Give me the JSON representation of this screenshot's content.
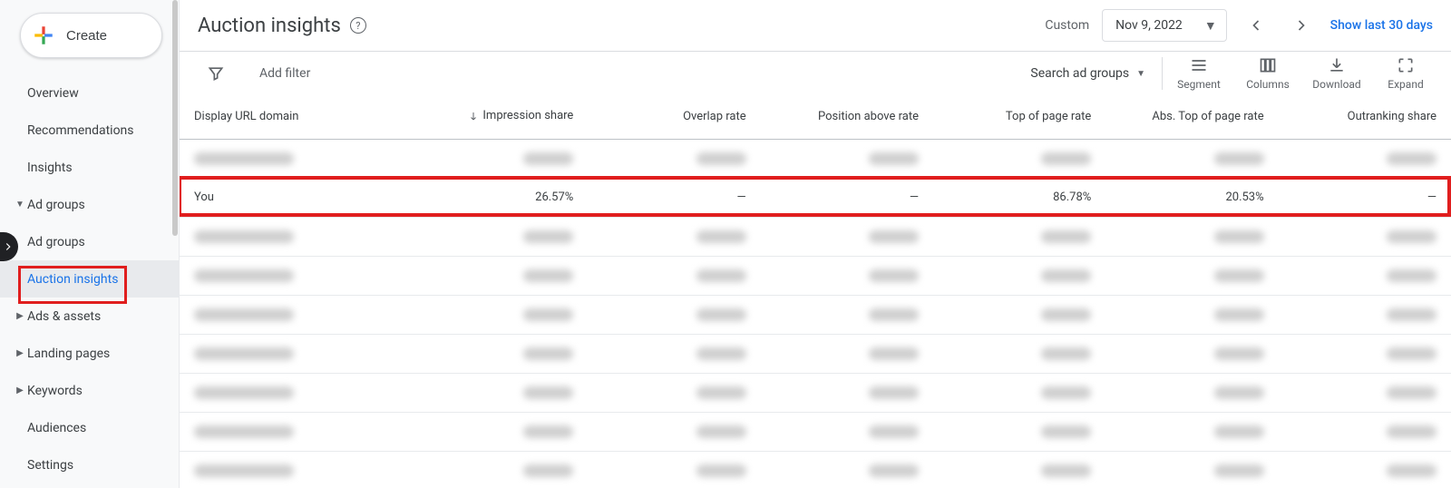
{
  "sidebar": {
    "create_label": "Create",
    "items": [
      {
        "label": "Overview",
        "type": "plain"
      },
      {
        "label": "Recommendations",
        "type": "plain"
      },
      {
        "label": "Insights",
        "type": "plain"
      },
      {
        "label": "Ad groups",
        "type": "expandable"
      },
      {
        "label": "Ad groups",
        "type": "sub"
      },
      {
        "label": "Auction insights",
        "type": "sub-active"
      },
      {
        "label": "Ads & assets",
        "type": "expandable-collapsed"
      },
      {
        "label": "Landing pages",
        "type": "expandable-collapsed"
      },
      {
        "label": "Keywords",
        "type": "expandable-collapsed"
      },
      {
        "label": "Audiences",
        "type": "plain"
      },
      {
        "label": "Settings",
        "type": "plain"
      }
    ]
  },
  "header": {
    "title": "Auction insights",
    "custom_label": "Custom",
    "date_value": "Nov 9, 2022",
    "last30_label": "Show last 30 days"
  },
  "filterbar": {
    "add_filter": "Add filter",
    "search_label": "Search ad groups",
    "tools": {
      "segment": "Segment",
      "columns": "Columns",
      "download": "Download",
      "expand": "Expand"
    }
  },
  "table": {
    "columns": [
      "Display URL domain",
      "Impression share",
      "Overlap rate",
      "Position above rate",
      "Top of page rate",
      "Abs. Top of page rate",
      "Outranking share"
    ],
    "sorted_column_index": 1,
    "you_row": {
      "domain": "You",
      "impression_share": "26.57%",
      "overlap_rate": "—",
      "position_above_rate": "—",
      "top_of_page_rate": "86.78%",
      "abs_top_of_page_rate": "20.53%",
      "outranking_share": "—"
    },
    "redacted_rows_before": 1,
    "redacted_rows_after": 7
  }
}
